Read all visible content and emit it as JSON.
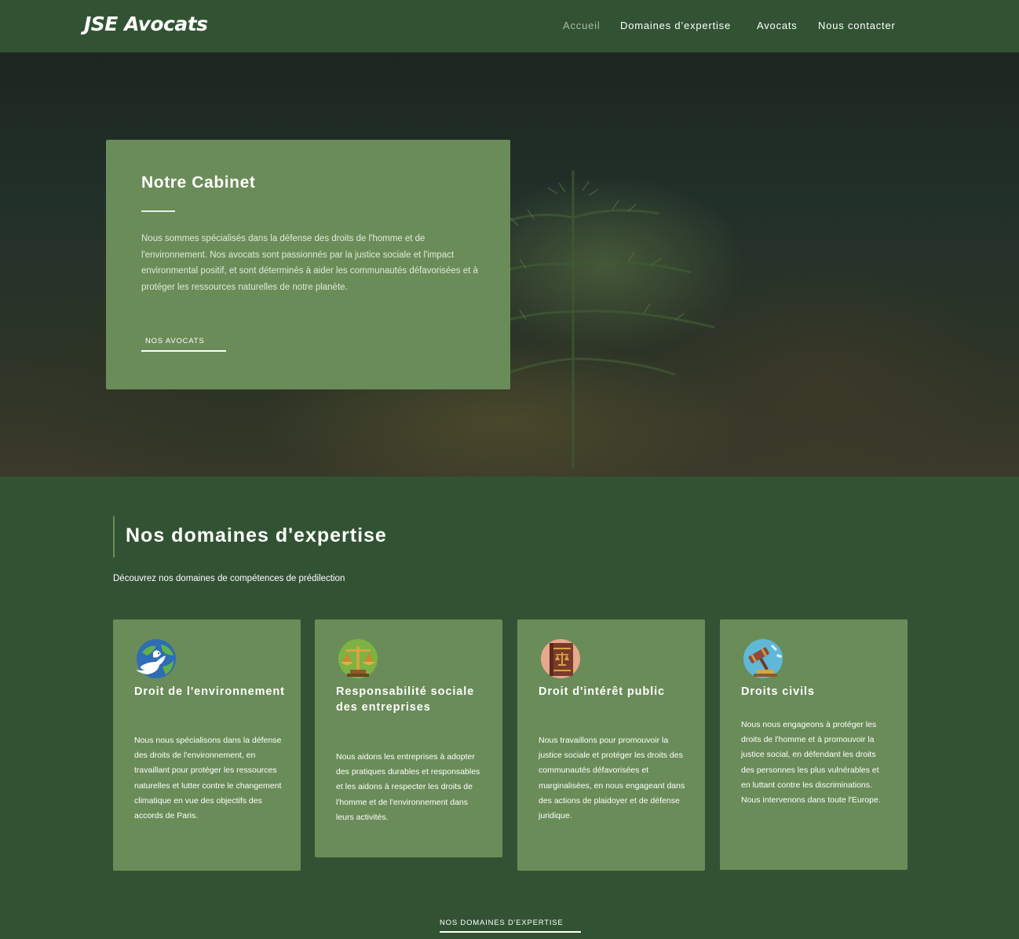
{
  "header": {
    "logo": "JSE Avocats",
    "nav": [
      {
        "label": "Accueil",
        "active": true
      },
      {
        "label": "Domaines d’expertise",
        "active": false
      },
      {
        "label": "Avocats",
        "active": false
      },
      {
        "label": "Nous contacter",
        "active": false
      }
    ]
  },
  "hero": {
    "background_image": "forest-seedling-photo",
    "card": {
      "title": "Notre Cabinet",
      "text": "Nous sommes spécialisés dans la défense des droits de l'homme et de l'environnement. Nos avocats sont passionnés par la justice sociale et l'impact environmental positif, et sont déterminés à aider les communautés défavorisées et à protéger les ressources naturelles de notre planète.",
      "button": "NOS AVOCATS"
    }
  },
  "expertise": {
    "title": "Nos domaines d'expertise",
    "subtitle": "Découvrez nos domaines de compétences de prédilection",
    "cards": [
      {
        "icon": "dove-earth-icon",
        "title": "Droit de l'environnement",
        "text": "Nous nous spécialisons dans la défense des droits de l'environnement, en travaillant pour protéger les ressources naturelles et lutter contre le changement climatique en vue des objectifs des accords de Paris."
      },
      {
        "icon": "scales-of-justice-icon",
        "title": "Responsabilité sociale des entreprises",
        "text": "Nous aidons les entreprises à adopter des pratiques durables et responsables et les aidons à respecter les droits de l'homme et de l'environnement dans leurs activités."
      },
      {
        "icon": "law-book-icon",
        "title": "Droit d'intérêt public",
        "text": "Nous travaillons pour promouvoir la justice sociale et protéger les droits des communautés défavorisées et marginalisées, en nous engageant dans des actions de plaidoyer et de défense juridique."
      },
      {
        "icon": "gavel-icon",
        "title": "Droits civils",
        "text": "Nous nous engageons à protéger les droits de l'homme et à promouvoir la justice social, en défendant les droits des personnes les plus vulnérables et en luttant contre les discriminations. Nous intervenons dans toute l'Europe."
      }
    ],
    "button": "NOS DOMAINES D'EXPERTISE"
  },
  "colors": {
    "background": "#325333",
    "card": "#6a8c58",
    "nav_active": "#a9bba6",
    "text": "#ffffff"
  }
}
